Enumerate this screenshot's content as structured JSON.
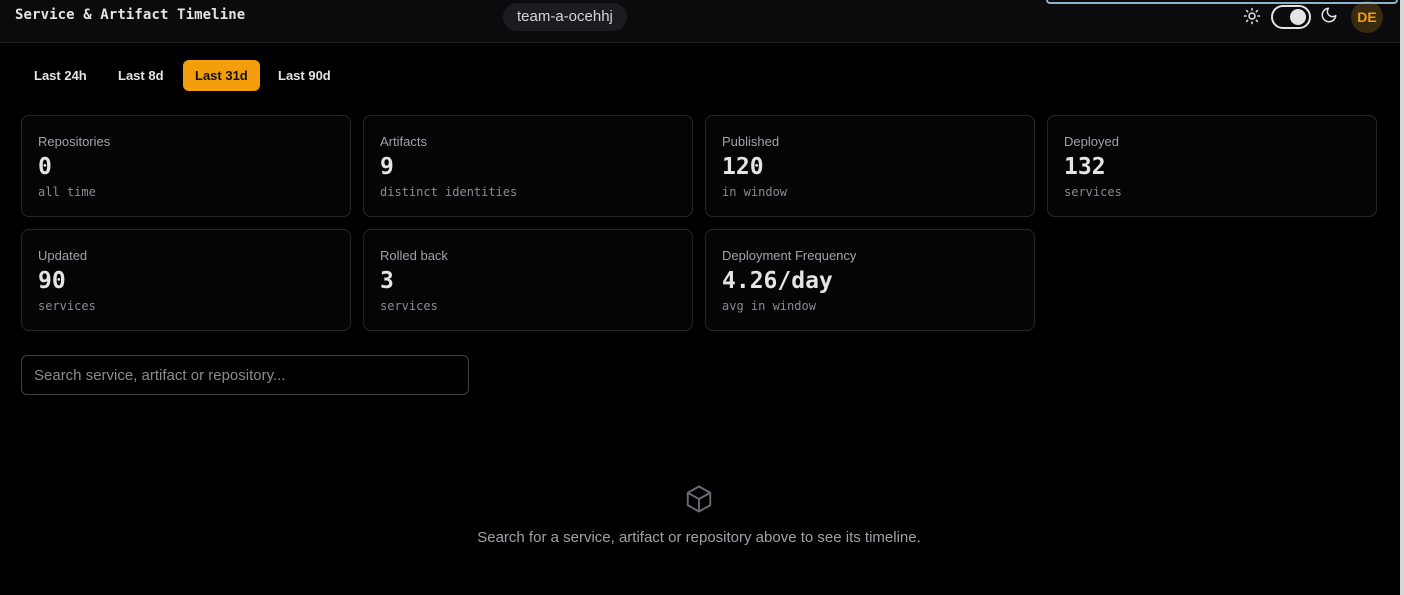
{
  "header": {
    "title": "Service & Artifact Timeline",
    "team": "team-a-ocehhj",
    "avatar_initials": "DE",
    "theme": "dark"
  },
  "colors": {
    "accent": "#f59e0b",
    "background": "#000000",
    "card_border": "#27272a"
  },
  "range_tabs": [
    {
      "label": "Last 24h",
      "active": false
    },
    {
      "label": "Last 8d",
      "active": false
    },
    {
      "label": "Last 31d",
      "active": true
    },
    {
      "label": "Last 90d",
      "active": false
    }
  ],
  "stats": [
    {
      "label": "Repositories",
      "value": "0",
      "sub": "all time"
    },
    {
      "label": "Artifacts",
      "value": "9",
      "sub": "distinct identities"
    },
    {
      "label": "Published",
      "value": "120",
      "sub": "in window"
    },
    {
      "label": "Deployed",
      "value": "132",
      "sub": "services"
    },
    {
      "label": "Updated",
      "value": "90",
      "sub": "services"
    },
    {
      "label": "Rolled back",
      "value": "3",
      "sub": "services"
    },
    {
      "label": "Deployment Frequency",
      "value": "4.26/day",
      "sub": "avg in window"
    }
  ],
  "search": {
    "placeholder": "Search service, artifact or repository...",
    "value": ""
  },
  "empty_state": {
    "icon": "package-icon",
    "message": "Search for a service, artifact or repository above to see its timeline."
  }
}
